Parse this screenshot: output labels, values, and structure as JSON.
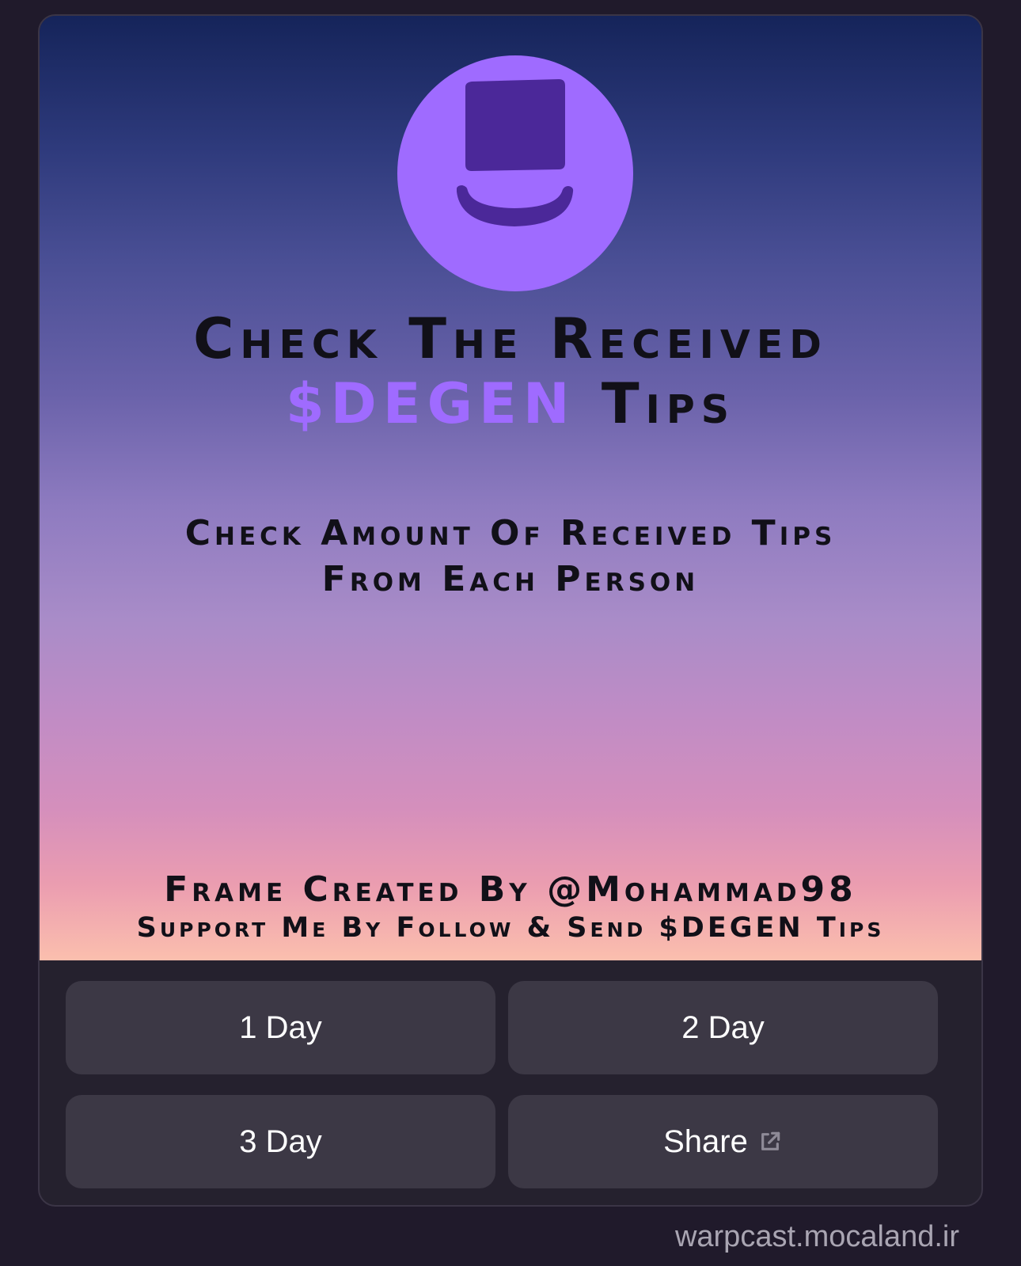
{
  "frame": {
    "title_line1": "Check The Received",
    "title_accent": "$DEGEN",
    "title_line2_rest": " Tips",
    "subtitle_line1": "Check Amount Of Received Tips",
    "subtitle_line2": "From Each Person",
    "credit_line1": "Frame Created By @Mohammad98",
    "credit_line2": "Support Me By Follow & Send $DEGEN Tips",
    "logo_icon": "top-hat-icon",
    "accent_color": "#9f6bff"
  },
  "buttons": [
    {
      "label": "1 Day"
    },
    {
      "label": "2 Day"
    },
    {
      "label": "3 Day"
    },
    {
      "label": "Share",
      "icon": "external-link-icon"
    }
  ],
  "footer": {
    "domain": "warpcast.mocaland.ir"
  }
}
